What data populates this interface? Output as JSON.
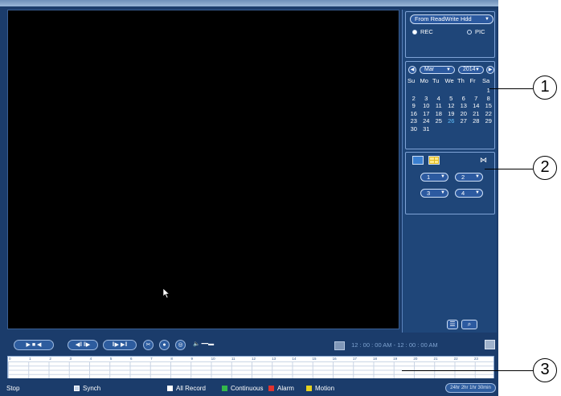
{
  "source": {
    "selected": "From ReadWrite Hdd",
    "radio_rec": "REC",
    "radio_pic": "PIC"
  },
  "calendar": {
    "month": "Mar",
    "year": "2014",
    "weekdays": [
      "Su",
      "Mo",
      "Tu",
      "We",
      "Th",
      "Fr",
      "Sa"
    ],
    "days": [
      "",
      "",
      "",
      "",
      "",
      "",
      "1",
      "2",
      "3",
      "4",
      "5",
      "6",
      "7",
      "8",
      "9",
      "10",
      "11",
      "12",
      "13",
      "14",
      "15",
      "16",
      "17",
      "18",
      "19",
      "20",
      "21",
      "22",
      "23",
      "24",
      "25",
      "26",
      "27",
      "28",
      "29",
      "30",
      "31"
    ],
    "highlight": [
      "26"
    ]
  },
  "channels": {
    "ch1": "1",
    "ch2": "2",
    "ch3": "3",
    "ch4": "4"
  },
  "time": {
    "start": "12 : 00 : 00 AM",
    "sep": "-",
    "end": "12 : 00 : 00 AM"
  },
  "timeline_hours": [
    "0",
    "1",
    "2",
    "3",
    "4",
    "5",
    "6",
    "7",
    "8",
    "9",
    "10",
    "11",
    "12",
    "13",
    "14",
    "15",
    "16",
    "17",
    "18",
    "19",
    "20",
    "21",
    "22",
    "23"
  ],
  "legend": {
    "status": "Stop",
    "synch": "Synch",
    "all_record": "All Record",
    "continuous": "Continuous",
    "alarm": "Alarm",
    "motion": "Motion",
    "zoom_modes": "24hr 2hr 1hr 30min"
  },
  "callouts": [
    "1",
    "2",
    "3"
  ],
  "colors": {
    "panel": "#1f4679",
    "accent": "#63c3ff",
    "continuous": "#33b84a",
    "alarm": "#e0332f",
    "motion": "#e6d21f",
    "all_record": "#ffffff"
  }
}
